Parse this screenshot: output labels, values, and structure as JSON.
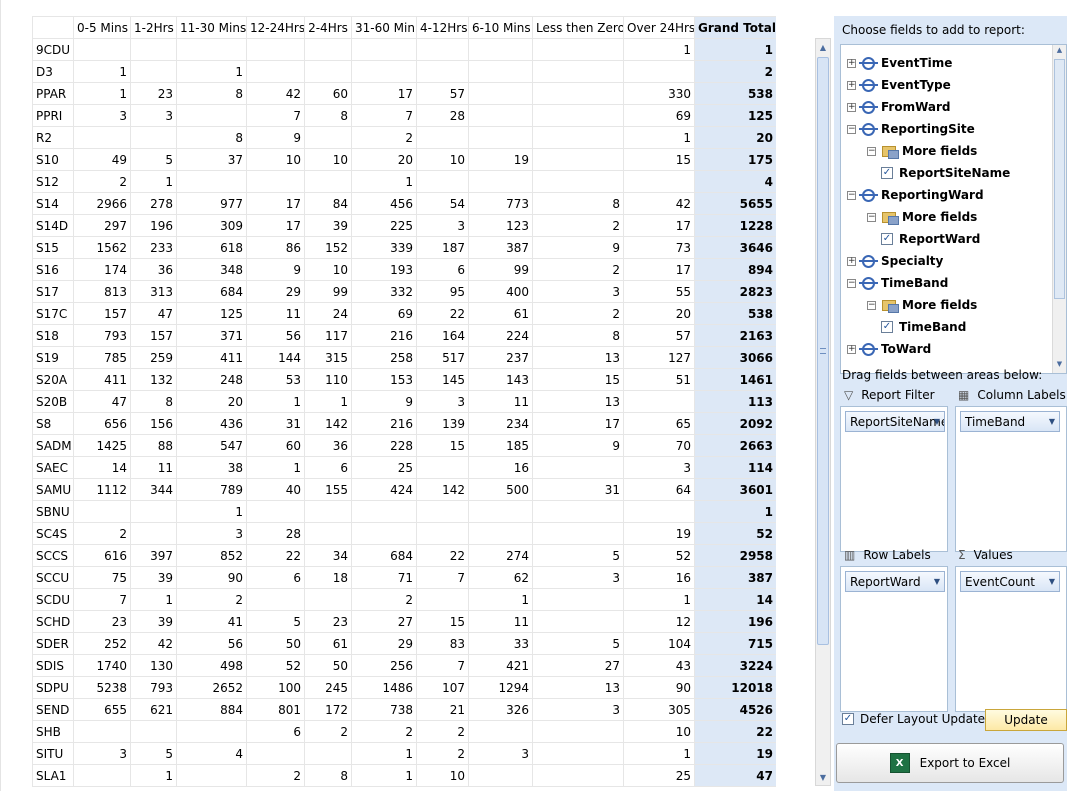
{
  "pivot": {
    "headers": [
      "",
      "0-5 Mins",
      "1-2Hrs",
      "11-30 Mins",
      "12-24Hrs",
      "2-4Hrs",
      "31-60 Min",
      "4-12Hrs",
      "6-10 Mins",
      "Less then Zero",
      "Over 24Hrs",
      "Grand Total"
    ],
    "rows": [
      [
        "9CDU",
        "",
        "",
        "",
        "",
        "",
        "",
        "",
        "",
        "",
        "1",
        "1"
      ],
      [
        "D3",
        "1",
        "",
        "1",
        "",
        "",
        "",
        "",
        "",
        "",
        "",
        "2"
      ],
      [
        "PPAR",
        "1",
        "23",
        "8",
        "42",
        "60",
        "17",
        "57",
        "",
        "",
        "330",
        "538"
      ],
      [
        "PPRI",
        "3",
        "3",
        "",
        "7",
        "8",
        "7",
        "28",
        "",
        "",
        "69",
        "125"
      ],
      [
        "R2",
        "",
        "",
        "8",
        "9",
        "",
        "2",
        "",
        "",
        "",
        "1",
        "20"
      ],
      [
        "S10",
        "49",
        "5",
        "37",
        "10",
        "10",
        "20",
        "10",
        "19",
        "",
        "15",
        "175"
      ],
      [
        "S12",
        "2",
        "1",
        "",
        "",
        "",
        "1",
        "",
        "",
        "",
        "",
        "4"
      ],
      [
        "S14",
        "2966",
        "278",
        "977",
        "17",
        "84",
        "456",
        "54",
        "773",
        "8",
        "42",
        "5655"
      ],
      [
        "S14D",
        "297",
        "196",
        "309",
        "17",
        "39",
        "225",
        "3",
        "123",
        "2",
        "17",
        "1228"
      ],
      [
        "S15",
        "1562",
        "233",
        "618",
        "86",
        "152",
        "339",
        "187",
        "387",
        "9",
        "73",
        "3646"
      ],
      [
        "S16",
        "174",
        "36",
        "348",
        "9",
        "10",
        "193",
        "6",
        "99",
        "2",
        "17",
        "894"
      ],
      [
        "S17",
        "813",
        "313",
        "684",
        "29",
        "99",
        "332",
        "95",
        "400",
        "3",
        "55",
        "2823"
      ],
      [
        "S17C",
        "157",
        "47",
        "125",
        "11",
        "24",
        "69",
        "22",
        "61",
        "2",
        "20",
        "538"
      ],
      [
        "S18",
        "793",
        "157",
        "371",
        "56",
        "117",
        "216",
        "164",
        "224",
        "8",
        "57",
        "2163"
      ],
      [
        "S19",
        "785",
        "259",
        "411",
        "144",
        "315",
        "258",
        "517",
        "237",
        "13",
        "127",
        "3066"
      ],
      [
        "S20A",
        "411",
        "132",
        "248",
        "53",
        "110",
        "153",
        "145",
        "143",
        "15",
        "51",
        "1461"
      ],
      [
        "S20B",
        "47",
        "8",
        "20",
        "1",
        "1",
        "9",
        "3",
        "11",
        "13",
        "",
        "113"
      ],
      [
        "S8",
        "656",
        "156",
        "436",
        "31",
        "142",
        "216",
        "139",
        "234",
        "17",
        "65",
        "2092"
      ],
      [
        "SADM",
        "1425",
        "88",
        "547",
        "60",
        "36",
        "228",
        "15",
        "185",
        "9",
        "70",
        "2663"
      ],
      [
        "SAEC",
        "14",
        "11",
        "38",
        "1",
        "6",
        "25",
        "",
        "16",
        "",
        "3",
        "114"
      ],
      [
        "SAMU",
        "1112",
        "344",
        "789",
        "40",
        "155",
        "424",
        "142",
        "500",
        "31",
        "64",
        "3601"
      ],
      [
        "SBNU",
        "",
        "",
        "1",
        "",
        "",
        "",
        "",
        "",
        "",
        "",
        "1"
      ],
      [
        "SC4S",
        "2",
        "",
        "3",
        "28",
        "",
        "",
        "",
        "",
        "",
        "19",
        "52"
      ],
      [
        "SCCS",
        "616",
        "397",
        "852",
        "22",
        "34",
        "684",
        "22",
        "274",
        "5",
        "52",
        "2958"
      ],
      [
        "SCCU",
        "75",
        "39",
        "90",
        "6",
        "18",
        "71",
        "7",
        "62",
        "3",
        "16",
        "387"
      ],
      [
        "SCDU",
        "7",
        "1",
        "2",
        "",
        "",
        "2",
        "",
        "1",
        "",
        "1",
        "14"
      ],
      [
        "SCHD",
        "23",
        "39",
        "41",
        "5",
        "23",
        "27",
        "15",
        "11",
        "",
        "12",
        "196"
      ],
      [
        "SDER",
        "252",
        "42",
        "56",
        "50",
        "61",
        "29",
        "83",
        "33",
        "5",
        "104",
        "715"
      ],
      [
        "SDIS",
        "1740",
        "130",
        "498",
        "52",
        "50",
        "256",
        "7",
        "421",
        "27",
        "43",
        "3224"
      ],
      [
        "SDPU",
        "5238",
        "793",
        "2652",
        "100",
        "245",
        "1486",
        "107",
        "1294",
        "13",
        "90",
        "12018"
      ],
      [
        "SEND",
        "655",
        "621",
        "884",
        "801",
        "172",
        "738",
        "21",
        "326",
        "3",
        "305",
        "4526"
      ],
      [
        "SHB",
        "",
        "",
        "",
        "6",
        "2",
        "2",
        "2",
        "",
        "",
        "10",
        "22"
      ],
      [
        "SITU",
        "3",
        "5",
        "4",
        "",
        "",
        "1",
        "2",
        "3",
        "",
        "1",
        "19"
      ],
      [
        "SLA1",
        "",
        "1",
        "",
        "2",
        "8",
        "1",
        "10",
        "",
        "",
        "25",
        "47"
      ]
    ]
  },
  "field_list": {
    "title": "Choose fields to add to report:",
    "fields": [
      {
        "label": "EventTime",
        "kind": "field",
        "expanded": false
      },
      {
        "label": "EventType",
        "kind": "field",
        "expanded": false
      },
      {
        "label": "FromWard",
        "kind": "field",
        "expanded": false
      },
      {
        "label": "ReportingSite",
        "kind": "field",
        "expanded": true
      },
      {
        "label": "More fields",
        "kind": "folder",
        "expanded": true
      },
      {
        "label": "ReportSiteName",
        "kind": "check",
        "checked": true
      },
      {
        "label": "ReportingWard",
        "kind": "field",
        "expanded": true
      },
      {
        "label": "More fields",
        "kind": "folder",
        "expanded": true
      },
      {
        "label": "ReportWard",
        "kind": "check",
        "checked": true
      },
      {
        "label": "Specialty",
        "kind": "field",
        "expanded": false
      },
      {
        "label": "TimeBand",
        "kind": "field",
        "expanded": true
      },
      {
        "label": "More fields",
        "kind": "folder",
        "expanded": true
      },
      {
        "label": "TimeBand",
        "kind": "check",
        "checked": true
      },
      {
        "label": "ToWard",
        "kind": "field",
        "expanded": false
      }
    ],
    "drag_title": "Drag fields between areas below:",
    "areas": {
      "report_filter": {
        "label": "Report Filter",
        "icon": "filter-icon",
        "value": "ReportSiteName"
      },
      "column_labels": {
        "label": "Column Labels",
        "icon": "columns-icon",
        "value": "TimeBand"
      },
      "row_labels": {
        "label": "Row Labels",
        "icon": "rows-icon",
        "value": "ReportWard"
      },
      "values": {
        "label": "Values",
        "icon": "sigma-icon",
        "value": "EventCount"
      }
    },
    "defer_label": "Defer Layout Update",
    "defer_checked": true,
    "update_label": "Update",
    "export_label": "Export to Excel"
  },
  "colors": {
    "grand_total_bg": "#dde8f6",
    "panel_bg": "#dce8f7",
    "update_button": "#fde9a6",
    "excel_green": "#1f7244"
  }
}
